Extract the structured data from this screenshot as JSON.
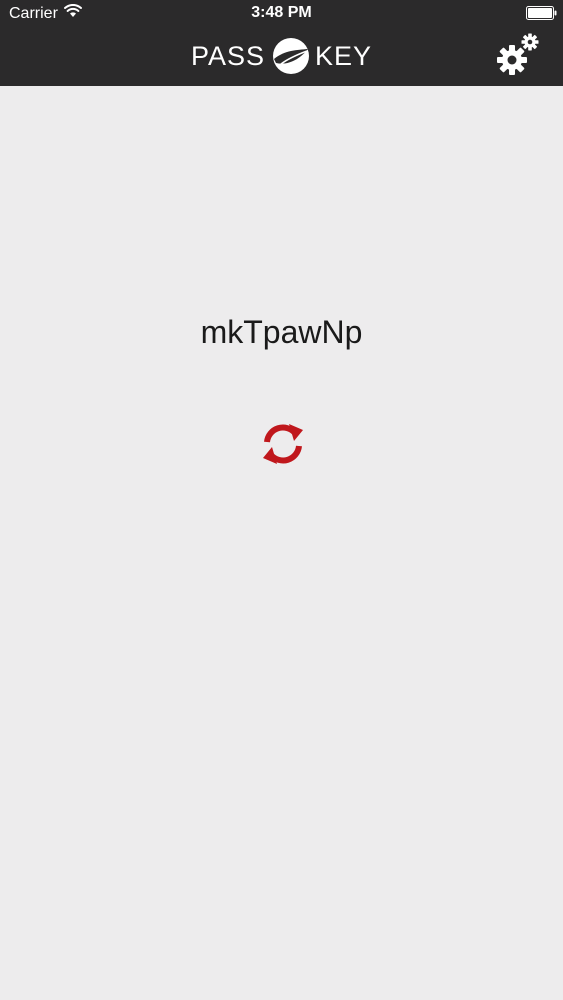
{
  "status_bar": {
    "carrier": "Carrier",
    "time": "3:48 PM"
  },
  "header": {
    "logo_left": "PASS",
    "logo_right": "KEY",
    "background_color": "#2b2a2b"
  },
  "main": {
    "generated_password": "mkTpawNp",
    "accent_color": "#c0171c",
    "background_color": "#edeced"
  },
  "icons": {
    "wifi": "wifi-icon",
    "battery": "battery-icon",
    "logo_mark": "passkey-logo-icon",
    "settings": "gears-icon",
    "refresh": "refresh-icon"
  }
}
